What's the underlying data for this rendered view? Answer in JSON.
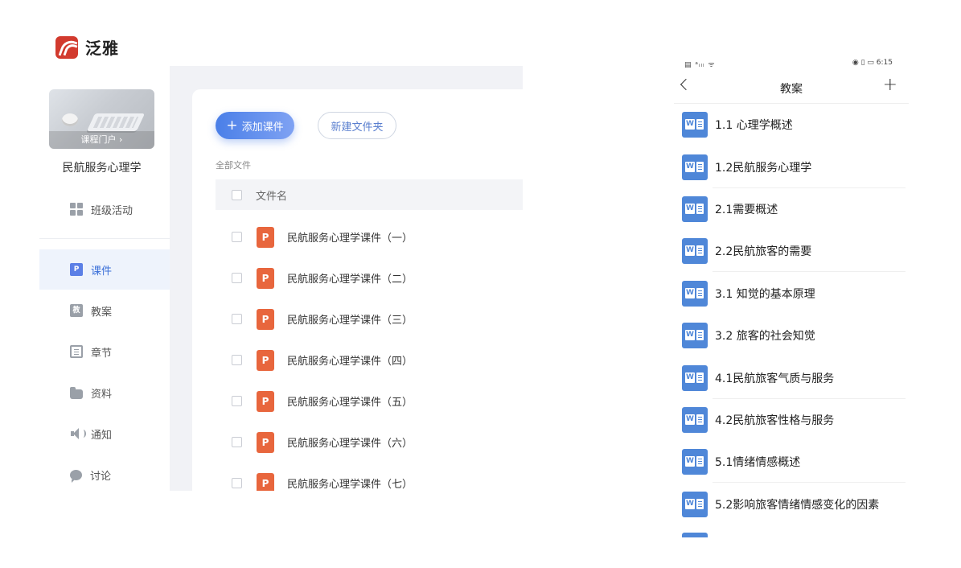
{
  "web": {
    "brand": "泛雅",
    "course": {
      "cover_button": "课程门户 ›",
      "name": "民航服务心理学"
    },
    "sidebar": {
      "items": [
        {
          "label": "班级活动",
          "icon": "grid-icon",
          "active": false
        },
        {
          "label": "课件",
          "icon": "courseware-icon",
          "active": true
        },
        {
          "label": "教案",
          "icon": "lesson-plan-icon",
          "active": false
        },
        {
          "label": "章节",
          "icon": "chapter-list-icon",
          "active": false
        },
        {
          "label": "资料",
          "icon": "folder-icon",
          "active": false
        },
        {
          "label": "通知",
          "icon": "speaker-icon",
          "active": false
        },
        {
          "label": "讨论",
          "icon": "chat-bubble-icon",
          "active": false
        }
      ]
    },
    "toolbar": {
      "add_label": "添加课件",
      "new_folder_label": "新建文件夹"
    },
    "breadcrumb": "全部文件",
    "table": {
      "header": "文件名",
      "files": [
        "民航服务心理学课件（一）",
        "民航服务心理学课件（二）",
        "民航服务心理学课件（三）",
        "民航服务心理学课件（四）",
        "民航服务心理学课件（五）",
        "民航服务心理学课件（六）",
        "民航服务心理学课件（七）"
      ]
    },
    "colors": {
      "accent": "#4a7fe8",
      "ppt": "#e8663d",
      "logo": "#d23a2e"
    }
  },
  "phone": {
    "status": {
      "left": "▤ ᵃᵢₗₗ ᯤ",
      "right": "◉ ▯ ▭ 6:15"
    },
    "title": "教案",
    "items": [
      "1.1 心理学概述",
      "1.2民航服务心理学",
      "2.1需要概述",
      "2.2民航旅客的需要",
      "3.1 知觉的基本原理",
      "3.2 旅客的社会知觉",
      "4.1民航旅客气质与服务",
      "4.2民航旅客性格与服务",
      "5.1情绪情感概述",
      "5.2影响旅客情绪情感变化的因素"
    ],
    "colors": {
      "word": "#4f87d8"
    }
  }
}
